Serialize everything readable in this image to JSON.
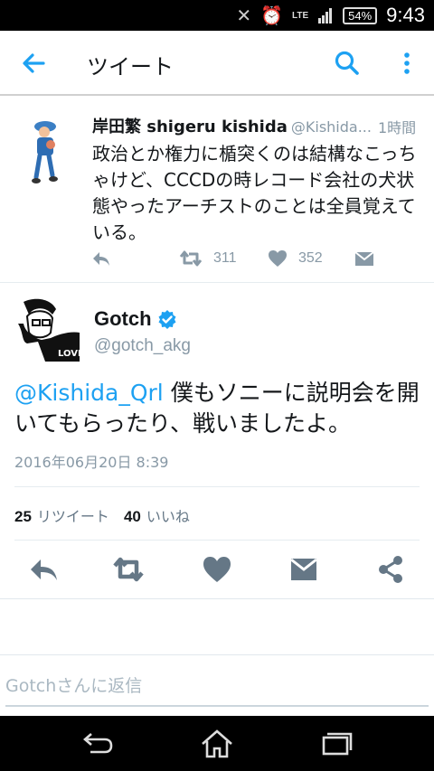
{
  "status_bar": {
    "network": "LTE",
    "battery": "54%",
    "time": "9:43"
  },
  "app_bar": {
    "title": "ツイート",
    "icons": [
      "back-arrow-icon",
      "search-icon",
      "more-vertical-icon"
    ]
  },
  "parent_tweet": {
    "author_name": "岸田繁 shigeru kishida",
    "handle": "@Kishida...",
    "time": "1時間",
    "text": "政治とか権力に楯突くのは結構なこっちゃけど、CCCDの時レコード会社の犬状態やったアーチストのことは全員覚えている。",
    "retweets": "311",
    "likes": "352"
  },
  "main_tweet": {
    "author_name": "Gotch",
    "handle": "@gotch_akg",
    "mention": "@Kishida_Qrl",
    "text": " 僕もソニーに説明会を開いてもらったり、戦いましたよ。",
    "date": "2016年06月20日 8:39",
    "retweet_count": "25",
    "retweet_label": "リツイート",
    "like_count": "40",
    "like_label": "いいね",
    "avatar_text": "LOVE"
  },
  "reply_box": {
    "placeholder": "Gotchさんに返信"
  },
  "colors": {
    "accent": "#1da1f2",
    "icon_gray": "#8899a6",
    "action_gray": "#657786"
  }
}
